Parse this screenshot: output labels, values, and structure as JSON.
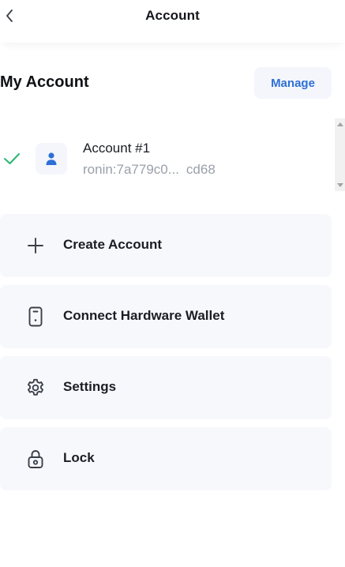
{
  "header": {
    "title": "Account",
    "back_icon": "chevron-left-icon"
  },
  "my_account": {
    "title": "My Account",
    "manage_label": "Manage"
  },
  "accounts": [
    {
      "name": "Account #1",
      "address_start": "ronin:7a779c0...",
      "address_end": "cd68",
      "selected": true,
      "icon": "user-icon"
    }
  ],
  "actions": [
    {
      "label": "Create Account",
      "icon": "plus-icon"
    },
    {
      "label": "Connect Hardware Wallet",
      "icon": "hardware-wallet-icon"
    },
    {
      "label": "Settings",
      "icon": "gear-icon"
    },
    {
      "label": "Lock",
      "icon": "lock-icon"
    }
  ],
  "colors": {
    "accent": "#2e6fd6",
    "check": "#2bb673",
    "card_bg": "#f7f8fc",
    "muted_text": "#9aa0aa",
    "text": "#1a1d24"
  }
}
